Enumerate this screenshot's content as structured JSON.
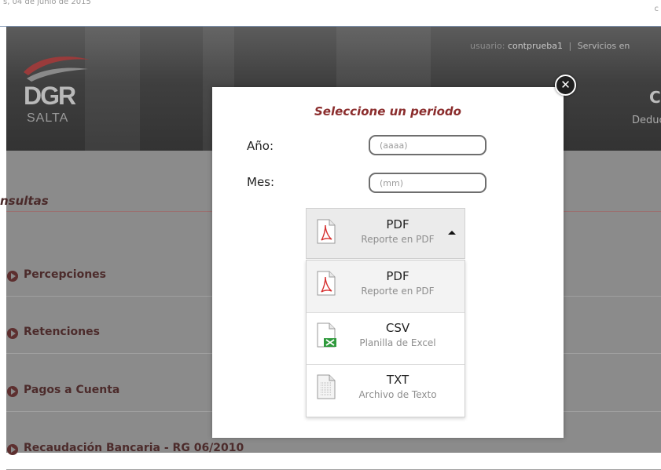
{
  "page": {
    "top_date": "s, 04 de junio de 2015",
    "top_right_letter": "c",
    "logo": {
      "brand": "DGR",
      "sub": "SALTA"
    },
    "user": {
      "label": "usuario:",
      "name": "contprueba1",
      "separator": "|",
      "services": "Servicios en"
    },
    "header_right_letter": "C",
    "header_right_text": "Deduc",
    "section_title": "nsultas",
    "nav_items": [
      {
        "label": "Percepciones"
      },
      {
        "label": "Retenciones"
      },
      {
        "label": "Pagos a Cuenta"
      },
      {
        "label": "Recaudación Bancaria - RG 06/2010"
      }
    ]
  },
  "modal": {
    "title": "Seleccione un periodo",
    "close_glyph": "✕",
    "year": {
      "label": "Año:",
      "placeholder": "(aaaa)",
      "value": ""
    },
    "month": {
      "label": "Mes:",
      "placeholder": "(mm)",
      "value": ""
    },
    "format_select": {
      "selected": {
        "name": "PDF",
        "description": "Reporte en PDF",
        "icon": "pdf-file-icon"
      },
      "options": [
        {
          "name": "PDF",
          "description": "Reporte en PDF",
          "icon": "pdf-file-icon"
        },
        {
          "name": "CSV",
          "description": "Planilla de Excel",
          "icon": "excel-file-icon"
        },
        {
          "name": "TXT",
          "description": "Archivo de Texto",
          "icon": "text-file-icon"
        }
      ]
    }
  },
  "colors": {
    "accent_title": "#8b2d2d",
    "header_bg": "#3f3f3f",
    "overlay_bg": "#8b8b8b",
    "pdf_red": "#d63030",
    "excel_green": "#2f9a3c"
  }
}
